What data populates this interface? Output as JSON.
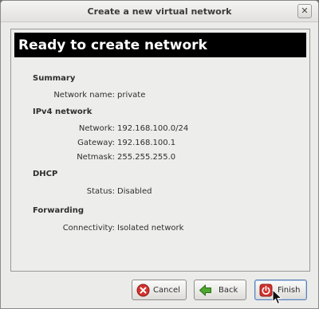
{
  "window": {
    "title": "Create a new virtual network",
    "close_glyph": "✕"
  },
  "banner": {
    "heading": "Ready to create network"
  },
  "summary": {
    "title": "Summary",
    "network_name_label": "Network name:",
    "network_name_value": "private"
  },
  "ipv4": {
    "title": "IPv4 network",
    "network_label": "Network:",
    "network_value": "192.168.100.0/24",
    "gateway_label": "Gateway:",
    "gateway_value": "192.168.100.1",
    "netmask_label": "Netmask:",
    "netmask_value": "255.255.255.0"
  },
  "dhcp": {
    "title": "DHCP",
    "status_label": "Status:",
    "status_value": "Disabled"
  },
  "forwarding": {
    "title": "Forwarding",
    "connectivity_label": "Connectivity:",
    "connectivity_value": "Isolated network"
  },
  "buttons": {
    "cancel_label": "Cancel",
    "back_label": "Back",
    "finish_label": "Finish"
  },
  "icons": {
    "close": "close-icon",
    "cancel": "cancel-icon",
    "back": "back-arrow-icon",
    "finish": "power-icon",
    "cursor": "mouse-pointer-icon"
  },
  "colors": {
    "banner_bg": "#000000",
    "banner_text": "#ffffff",
    "cancel_icon": "#d0312d",
    "back_icon": "#4ea72e",
    "finish_icon": "#d0312d"
  }
}
